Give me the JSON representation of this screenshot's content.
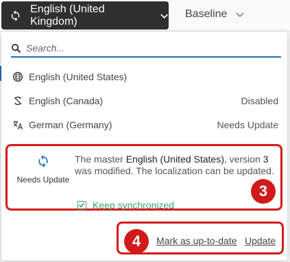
{
  "toolbar": {
    "selected_language": "English (United Kingdom)",
    "baseline_label": "Baseline"
  },
  "search": {
    "placeholder": "Search..."
  },
  "languages": [
    {
      "name": "English (United States)",
      "status": "",
      "icon": "globe-icon"
    },
    {
      "name": "English (Canada)",
      "status": "Disabled",
      "icon": "sync-disabled-icon"
    },
    {
      "name": "German (Germany)",
      "status": "Needs Update",
      "icon": "translate-icon"
    }
  ],
  "status_panel": {
    "state_label": "Needs Update",
    "msg_pre": "The master ",
    "msg_master": "English (United States)",
    "msg_mid": ", version ",
    "msg_version": "3",
    "msg_post": " was modified. The localization can be updated.",
    "keep_sync_label": "Keep synchronized",
    "keep_sync_checked": true
  },
  "actions": {
    "mark_up_to_date": "Mark as up-to-date",
    "update": "Update"
  },
  "callouts": {
    "first": "3",
    "second": "4"
  },
  "colors": {
    "accent": "#1e6fb3",
    "callout": "#d11a1a",
    "success": "#3aa36b",
    "button_dark": "#2f2f2f"
  }
}
